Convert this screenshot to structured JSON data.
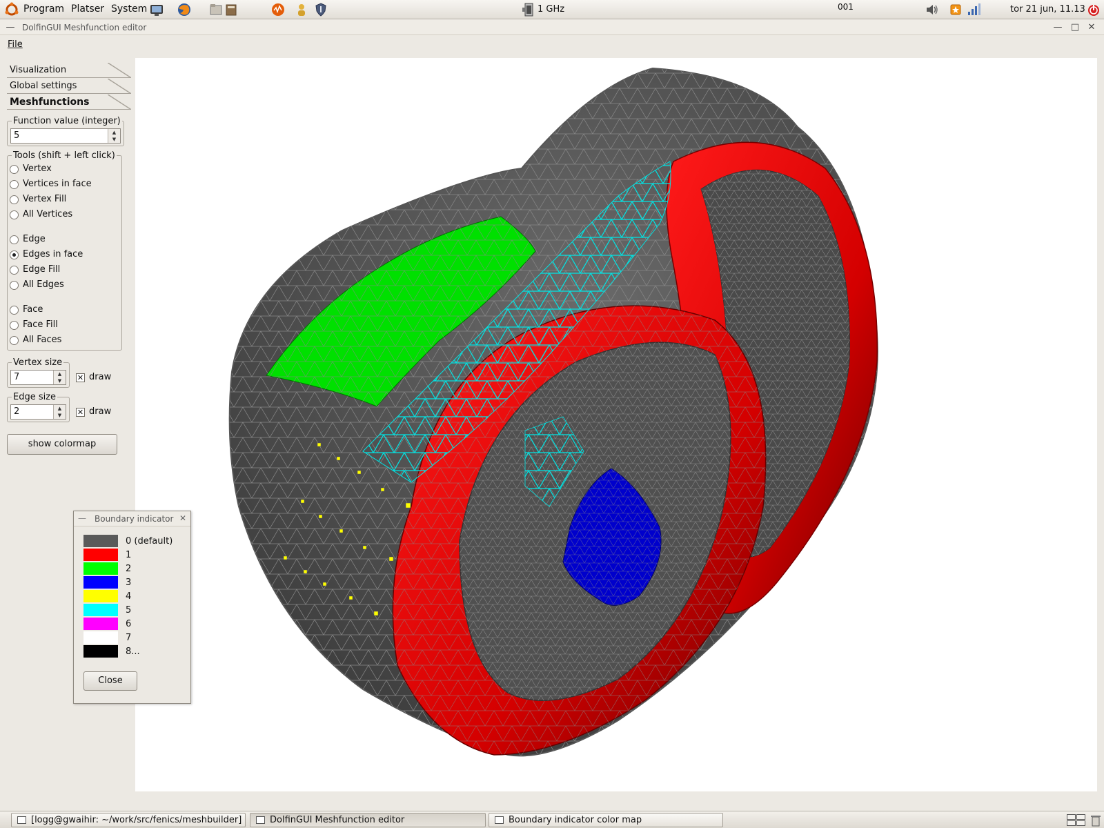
{
  "top_panel": {
    "menus": [
      "Program",
      "Platser",
      "System"
    ],
    "cpu_freq": "1 GHz",
    "workspace_label": "001",
    "clock": "tor 21 jun, 11.13",
    "icons": [
      "ubuntu-logo-icon",
      "monitor-lock-icon",
      "firefox-icon",
      "file-manager-icon",
      "book-icon",
      "sound-juicer-icon",
      "person-icon",
      "shield-icon",
      "cpu-freq-icon",
      "volume-icon",
      "update-notifier-icon",
      "network-signal-icon",
      "power-icon"
    ]
  },
  "window": {
    "title": "DolfinGUI Meshfunction editor",
    "menu_file": "File"
  },
  "left_panel": {
    "tabs": [
      {
        "label": "Visualization"
      },
      {
        "label": "Global settings"
      },
      {
        "label": "Meshfunctions"
      }
    ],
    "function_value": {
      "legend": "Function value (integer)",
      "value": "5"
    },
    "tools": {
      "legend": "Tools (shift + left click)",
      "options": [
        "Vertex",
        "Vertices in face",
        "Vertex Fill",
        "All Vertices",
        "Edge",
        "Edges in face",
        "Edge Fill",
        "All Edges",
        "Face",
        "Face Fill",
        "All Faces"
      ],
      "selected": "Edges in face"
    },
    "vertex_size": {
      "legend": "Vertex size",
      "value": "7",
      "draw_label": "draw",
      "draw_checked": true
    },
    "edge_size": {
      "legend": "Edge size",
      "value": "2",
      "draw_label": "draw",
      "draw_checked": true
    },
    "colormap_button": "show colormap"
  },
  "boundary_dialog": {
    "title": "Boundary indicator",
    "entries": [
      {
        "label": "0 (default)",
        "color": "#5a5a5a"
      },
      {
        "label": "1",
        "color": "#ff0000"
      },
      {
        "label": "2",
        "color": "#00ff00"
      },
      {
        "label": "3",
        "color": "#0000ff"
      },
      {
        "label": "4",
        "color": "#ffff00"
      },
      {
        "label": "5",
        "color": "#00ffff"
      },
      {
        "label": "6",
        "color": "#ff00ff"
      },
      {
        "label": "7",
        "color": "#ffffff"
      },
      {
        "label": "8...",
        "color": "#000000"
      }
    ],
    "close_label": "Close"
  },
  "taskbar": {
    "tasks": [
      {
        "label": "[logg@gwaihir: ~/work/src/fenics/meshbuilder]"
      },
      {
        "label": "DolfinGUI Meshfunction editor"
      },
      {
        "label": "Boundary indicator color map"
      }
    ]
  },
  "colors": {
    "mesh_gray": "#5a5a5a",
    "mesh_red": "#e00000",
    "mesh_green": "#00e000",
    "mesh_blue": "#0000cc",
    "mesh_cyan": "#00e5e5",
    "vertex_yellow": "#ffff00"
  }
}
